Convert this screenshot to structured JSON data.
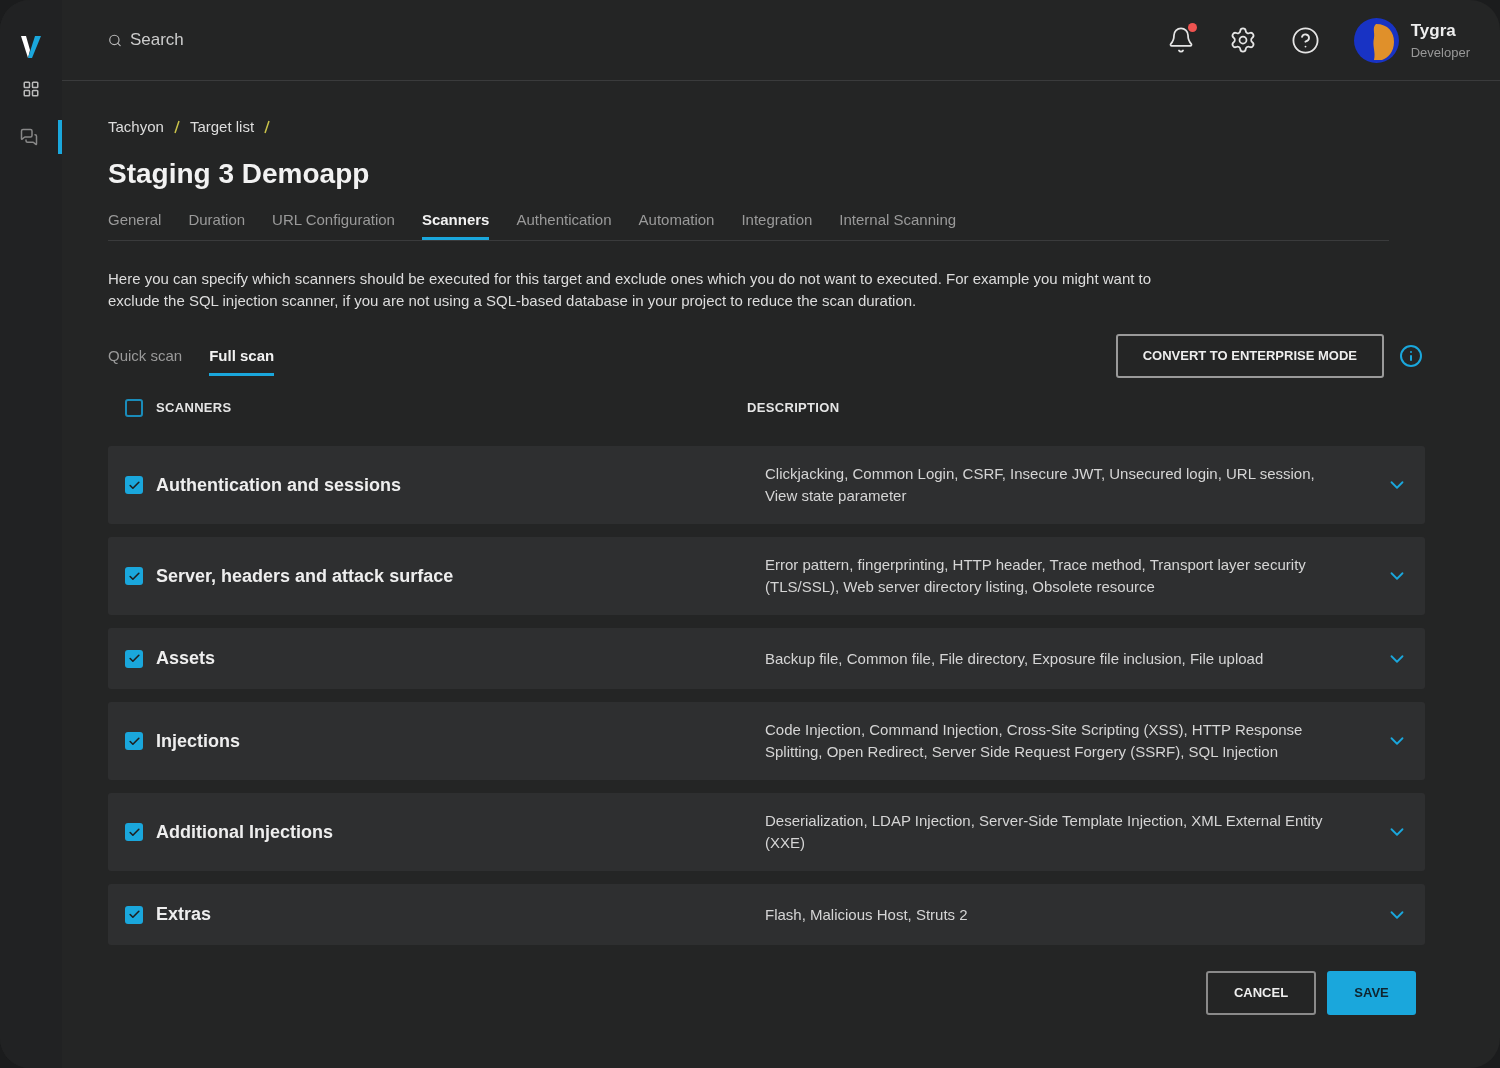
{
  "sidebar": {
    "items": [
      {
        "kind": "grid",
        "selected": false
      },
      {
        "kind": "chat",
        "selected": true
      }
    ]
  },
  "header": {
    "search": {
      "placeholder": "Search"
    },
    "notifications": {
      "unread": true
    },
    "user": {
      "name": "Tygra",
      "role": "Developer"
    }
  },
  "breadcrumb": [
    "Tachyon",
    "Target list"
  ],
  "title": "Staging 3 Demoapp",
  "tabs": [
    {
      "label": "General",
      "selected": false
    },
    {
      "label": "Duration",
      "selected": false
    },
    {
      "label": "URL Configuration",
      "selected": false
    },
    {
      "label": "Scanners",
      "selected": true
    },
    {
      "label": "Authentication",
      "selected": false
    },
    {
      "label": "Automation",
      "selected": false
    },
    {
      "label": "Integration",
      "selected": false
    },
    {
      "label": "Internal Scanning",
      "selected": false
    }
  ],
  "intro": "Here you can specify which scanners should be executed for this target and exclude ones which you do not want to executed. For example you might want to exclude the SQL injection scanner, if you are not using a SQL-based database in your project to reduce the scan duration.",
  "scan_tabs": [
    {
      "label": "Quick scan",
      "selected": false
    },
    {
      "label": "Full scan",
      "selected": true
    }
  ],
  "convert_button": "CONVERT TO ENTERPRISE MODE",
  "table": {
    "columns": [
      "SCANNERS",
      "DESCRIPTION"
    ],
    "all_checked": false,
    "rows": [
      {
        "name": "Authentication and sessions",
        "description": "Clickjacking, Common Login, CSRF, Insecure JWT, Unsecured login, URL session, View state parameter",
        "checked": true
      },
      {
        "name": "Server, headers and attack surface",
        "description": "Error pattern, fingerprinting, HTTP header, Trace method, Transport layer security (TLS/SSL), Web server directory listing, Obsolete resource",
        "checked": true
      },
      {
        "name": "Assets",
        "description": "Backup file, Common file, File directory, Exposure file inclusion, File upload",
        "checked": true
      },
      {
        "name": "Injections",
        "description": "Code Injection, Command Injection, Cross-Site Scripting (XSS), HTTP Response Splitting, Open Redirect, Server Side Request Forgery (SSRF), SQL Injection",
        "checked": true
      },
      {
        "name": "Additional Injections",
        "description": "Deserialization, LDAP Injection, Server-Side Template Injection, XML External Entity (XXE)",
        "checked": true
      },
      {
        "name": "Extras",
        "description": "Flash, Malicious Host, Struts 2",
        "checked": true
      }
    ]
  },
  "buttons": [
    "CANCEL",
    "SAVE"
  ]
}
